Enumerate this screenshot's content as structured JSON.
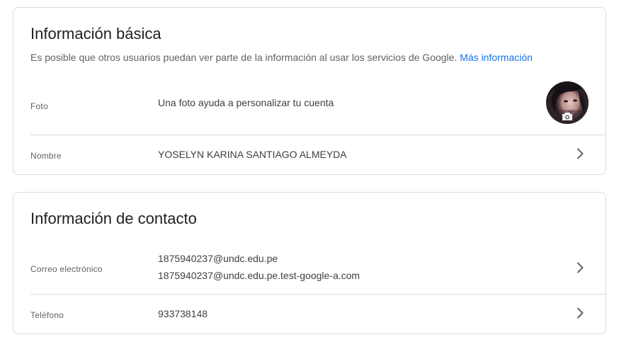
{
  "basic": {
    "title": "Información básica",
    "subtitle": "Es posible que otros usuarios puedan ver parte de la información al usar los servicios de Google.",
    "more_link": "Más información",
    "photo": {
      "label": "Foto",
      "value": "Una foto ayuda a personalizar tu cuenta"
    },
    "name": {
      "label": "Nombre",
      "value": "YOSELYN KARINA SANTIAGO ALMEYDA"
    }
  },
  "contact": {
    "title": "Información de contacto",
    "email": {
      "label": "Correo electrónico",
      "values": [
        "1875940237@undc.edu.pe",
        "1875940237@undc.edu.pe.test-google-a.com"
      ]
    },
    "phone": {
      "label": "Teléfono",
      "value": "933738148"
    }
  },
  "colors": {
    "link": "#1a73e8",
    "border": "#dadce0",
    "secondary_text": "#5f6368"
  },
  "icons": [
    "chevron-right-icon",
    "camera-icon"
  ]
}
